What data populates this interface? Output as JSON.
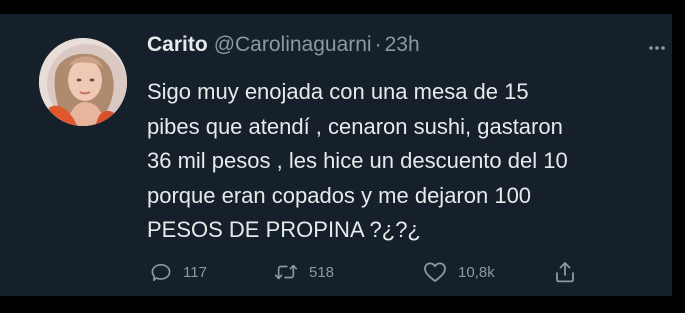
{
  "author": {
    "name": "Carito",
    "handle": "@Carolinaguarni",
    "separator": "·",
    "time": "23h"
  },
  "tweet": {
    "lines": [
      "Sigo muy enojada con una mesa de 15",
      "pibes que atendí , cenaron sushi, gastaron",
      "36 mil pesos , les hice un descuento del 10",
      "porque eran copados y me dejaron 100",
      "PESOS DE PROPINA ?¿?¿"
    ]
  },
  "actions": {
    "reply_count": "117",
    "retweet_count": "518",
    "like_count": "10,8k"
  },
  "icons": {
    "reply": "reply-icon",
    "retweet": "retweet-icon",
    "like": "heart-icon",
    "share": "share-icon",
    "more": "more-options-icon"
  },
  "colors": {
    "background": "#15202b",
    "outer": "#000000",
    "text_primary": "#e7e9ea",
    "text_secondary": "#8b98a5"
  }
}
